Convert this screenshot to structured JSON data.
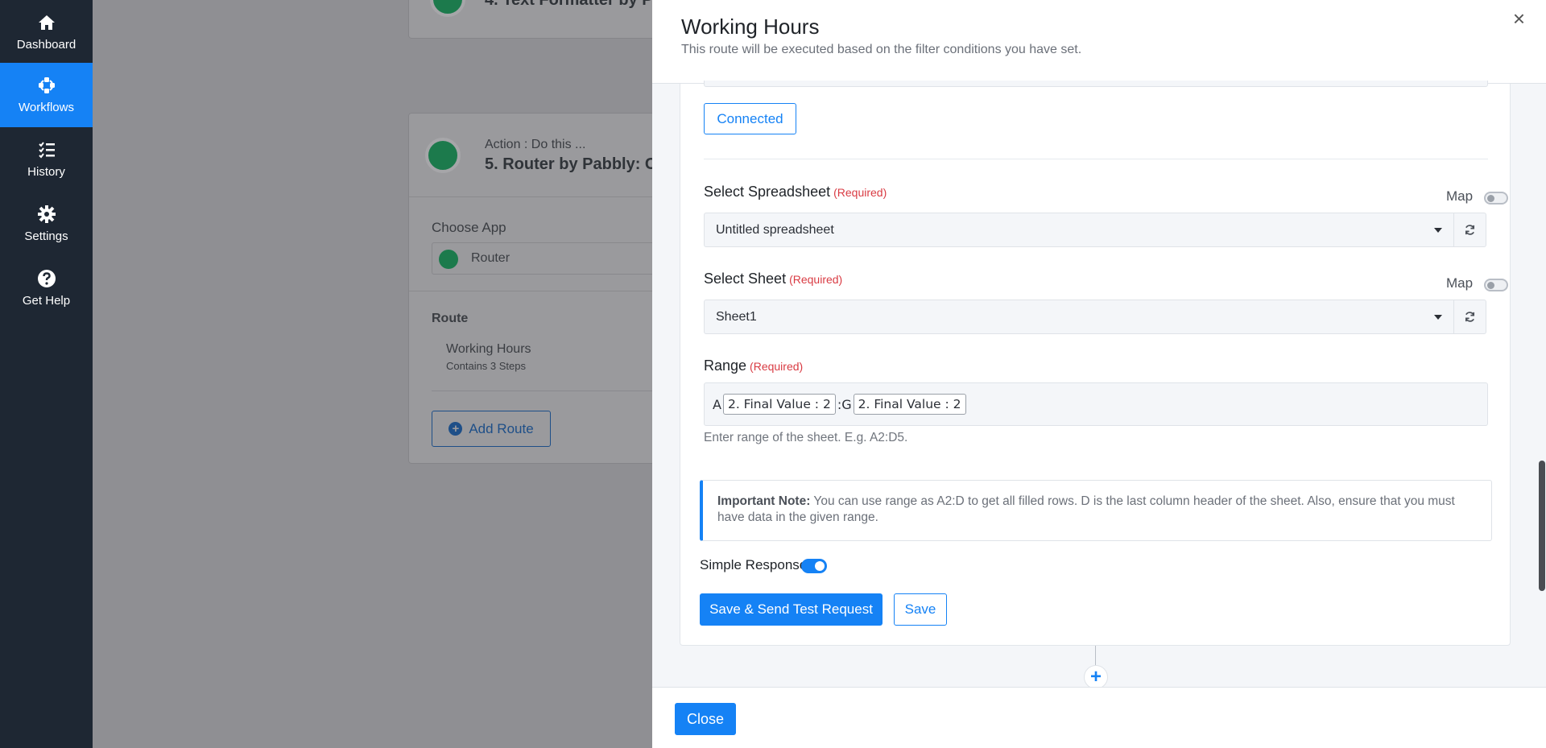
{
  "sidebar": {
    "items": [
      {
        "label": "Dashboard",
        "icon": "home-icon"
      },
      {
        "label": "Workflows",
        "icon": "workflow-icon",
        "active": true
      },
      {
        "label": "History",
        "icon": "history-icon"
      },
      {
        "label": "Settings",
        "icon": "gear-icon"
      },
      {
        "label": "Get Help",
        "icon": "help-icon"
      }
    ]
  },
  "background": {
    "step4_title": "4. Text Formatter by P",
    "step5_action": "Action : Do this ...",
    "step5_title": "5. Router by Pabbly: C",
    "choose_app_label": "Choose App",
    "choose_app_value": "Router",
    "route_label": "Route",
    "route_name": "Working Hours",
    "route_steps": "Contains 3 Steps",
    "add_route_label": "Add Route"
  },
  "modal": {
    "title": "Working Hours",
    "subtitle": "This route will be executed based on the filter conditions you have set.",
    "connected_label": "Connected",
    "spreadsheet": {
      "label": "Select Spreadsheet",
      "required": "(Required)",
      "map_label": "Map",
      "value": "Untitled spreadsheet"
    },
    "sheet": {
      "label": "Select Sheet",
      "required": "(Required)",
      "map_label": "Map",
      "value": "Sheet1"
    },
    "range": {
      "label": "Range",
      "required": "(Required)",
      "prefix": "A",
      "chip1": "2. Final Value : 2",
      "separator": ":G",
      "chip2": "2. Final Value : 2",
      "hint": "Enter range of the sheet. E.g. A2:D5."
    },
    "note": {
      "bold": "Important Note:",
      "text": " You can use range as A2:D to get all filled rows. D is the last column header of the sheet. Also, ensure that you must have data in the given range."
    },
    "simple_response_label": "Simple Response",
    "save_send_label": "Save & Send Test Request",
    "save_label": "Save",
    "close_label": "Close",
    "close_x": "×",
    "add_step": "+"
  },
  "colors": {
    "accent": "#1582f5",
    "sidebar_bg": "#1e2733",
    "required": "#d93b43"
  }
}
